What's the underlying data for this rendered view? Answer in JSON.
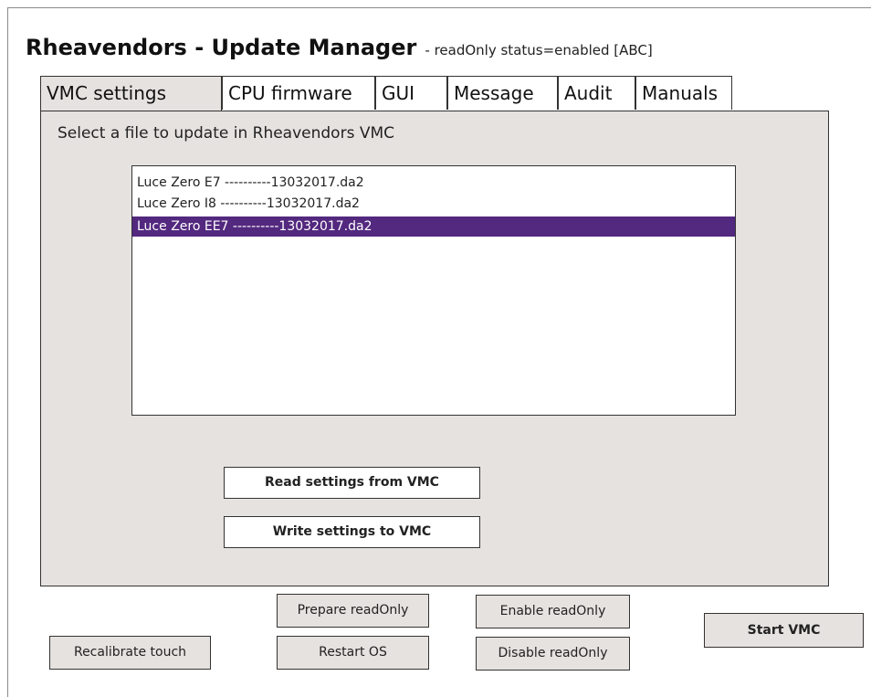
{
  "header": {
    "title": "Rheavendors - Update Manager",
    "status": "- readOnly status=enabled [ABC]"
  },
  "tabs": [
    {
      "label": "VMC settings",
      "active": true
    },
    {
      "label": "CPU firmware",
      "active": false
    },
    {
      "label": "GUI",
      "active": false
    },
    {
      "label": "Message",
      "active": false
    },
    {
      "label": "Audit",
      "active": false
    },
    {
      "label": "Manuals",
      "active": false
    }
  ],
  "panel": {
    "heading": "Select a file to update in Rheavendors VMC",
    "files": [
      {
        "label": "Luce Zero E7 ----------13032017.da2",
        "selected": false
      },
      {
        "label": "Luce Zero I8 ----------13032017.da2",
        "selected": false
      },
      {
        "label": "Luce Zero EE7 ----------13032017.da2",
        "selected": true
      }
    ],
    "read_button": "Read settings from VMC",
    "write_button": "Write settings to VMC"
  },
  "footer": {
    "prepare_readonly": "Prepare readOnly",
    "enable_readonly": "Enable readOnly",
    "recalibrate_touch": "Recalibrate touch",
    "restart_os": "Restart OS",
    "disable_readonly": "Disable readOnly",
    "start_vmc": "Start VMC"
  },
  "colors": {
    "panel_bg": "#e6e2df",
    "selection": "#53287f",
    "border": "#333333"
  }
}
